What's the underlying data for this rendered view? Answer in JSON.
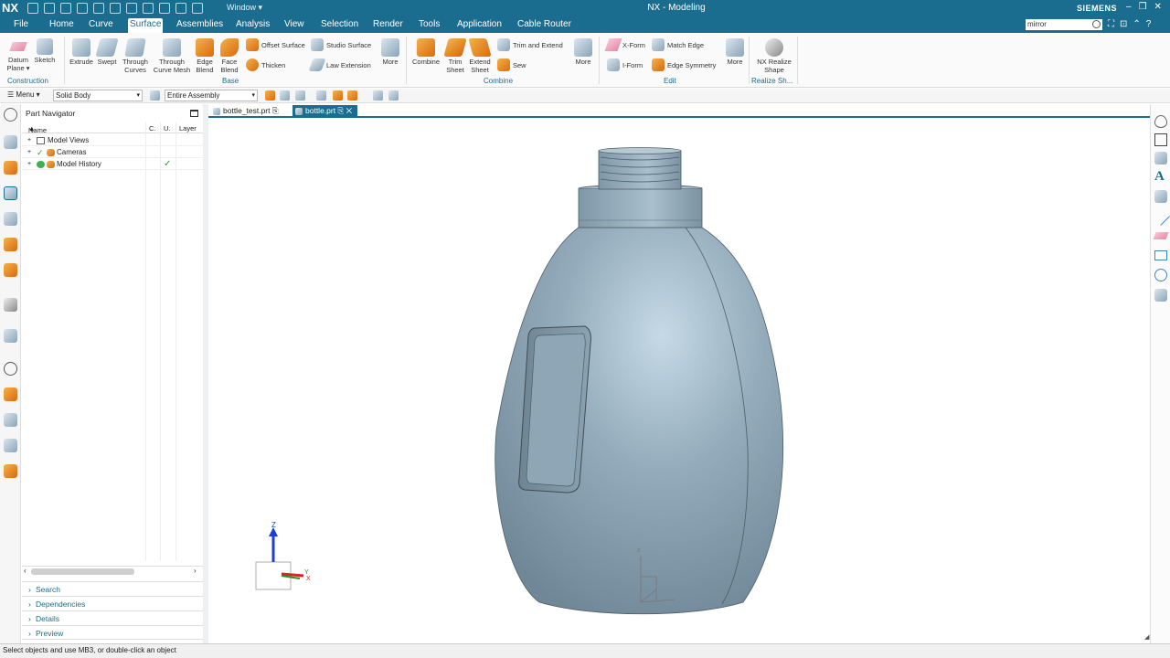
{
  "app": {
    "logo": "NX",
    "window_menu": "Window ▾",
    "title": "NX - Modeling",
    "brand": "SIEMENS"
  },
  "menu": {
    "tabs": [
      "File",
      "Home",
      "Curve",
      "Surface",
      "Assemblies",
      "Analysis",
      "View",
      "Selection",
      "Render",
      "Tools",
      "Application",
      "Cable Router"
    ],
    "active_tab": "Surface",
    "search_value": "mirror"
  },
  "ribbon": {
    "construction": {
      "datum_plane": "Datum Plane ▾",
      "sketch": "Sketch",
      "group": "Construction"
    },
    "base": {
      "extrude": "Extrude",
      "swept": "Swept",
      "through_curves": "Through Curves",
      "through_curve_mesh": "Through Curve Mesh",
      "edge_blend": "Edge Blend",
      "face_blend": "Face Blend",
      "offset_surface": "Offset Surface",
      "studio_surface": "Studio Surface",
      "thicken": "Thicken",
      "law_extension": "Law Extension",
      "more": "More",
      "group": "Base"
    },
    "combine": {
      "combine": "Combine",
      "trim_sheet": "Trim Sheet",
      "extend_sheet": "Extend Sheet",
      "trim_and_extend": "Trim and Extend",
      "sew": "Sew",
      "more": "More",
      "group": "Combine"
    },
    "edit": {
      "x_form": "X-Form",
      "match_edge": "Match Edge",
      "i_form": "I-Form",
      "edge_symmetry": "Edge Symmetry",
      "more": "More",
      "group": "Edit"
    },
    "realize": {
      "nx_realize_shape": "NX Realize Shape",
      "group": "Realize Sh..."
    }
  },
  "commandbar": {
    "menu": "Menu ▾",
    "type_filter": "Solid Body",
    "scope": "Entire Assembly"
  },
  "navigator": {
    "title": "Part Navigator",
    "columns": {
      "name": "Name",
      "c": "C.",
      "u": "U.",
      "layer": "Layer"
    },
    "rows": [
      "Model Views",
      "Cameras",
      "Model History"
    ],
    "sections": [
      "Search",
      "Dependencies",
      "Details",
      "Preview"
    ]
  },
  "tabs": [
    {
      "label": "bottle_test.prt"
    },
    {
      "label": "bottle.prt"
    }
  ],
  "triad": {
    "z": "Z",
    "x": "X",
    "y": "Y"
  },
  "status": "Select objects and use MB3, or double-click an object",
  "colors": {
    "accent": "#1b6d8f",
    "bottle": "#8fa7b7"
  }
}
